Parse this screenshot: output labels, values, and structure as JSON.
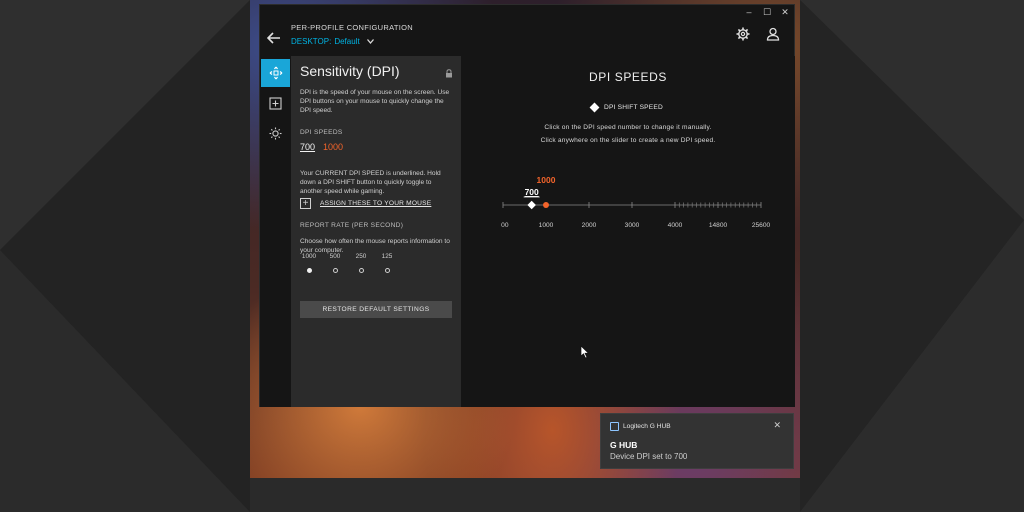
{
  "header": {
    "kicker": "PER-PROFILE CONFIGURATION",
    "profile_prefix": "DESKTOP:",
    "profile_name": "Default",
    "icons": [
      "back-arrow-icon",
      "gear-icon",
      "user-icon"
    ]
  },
  "window_controls": [
    "–",
    "☐",
    "✕"
  ],
  "rail": {
    "items": [
      {
        "name": "sensitivity",
        "icon": "move-arrows-icon",
        "active": true
      },
      {
        "name": "assignments",
        "icon": "plus-box-icon",
        "active": false
      },
      {
        "name": "lighting",
        "icon": "sun-icon",
        "active": false
      }
    ]
  },
  "panel": {
    "title": "Sensitivity (DPI)",
    "description": "DPI is the speed of your mouse on the screen. Use DPI buttons on your mouse to quickly change the DPI speed.",
    "dpi_speeds_label": "DPI SPEEDS",
    "dpi_speeds": {
      "current": "700",
      "shift": "1000"
    },
    "current_note": "Your CURRENT DPI SPEED is underlined. Hold down a DPI SHIFT button to quickly toggle to another speed while gaming.",
    "assign_label": "ASSIGN THESE TO YOUR MOUSE",
    "report_rate_label": "REPORT RATE (PER SECOND)",
    "report_rate_desc": "Choose how often the mouse reports information to your computer.",
    "report_rates": [
      {
        "value": "1000",
        "selected": true
      },
      {
        "value": "500",
        "selected": false
      },
      {
        "value": "250",
        "selected": false
      },
      {
        "value": "125",
        "selected": false
      }
    ],
    "restore_label": "RESTORE DEFAULT SETTINGS"
  },
  "main": {
    "title": "DPI SPEEDS",
    "shift_legend": "DPI SHIFT SPEED",
    "hint_1": "Click on the DPI speed number to change it manually.",
    "hint_2": "Click anywhere on the slider to create a new DPI speed."
  },
  "slider": {
    "scale_labels": [
      "100",
      "1000",
      "2000",
      "3000",
      "4000",
      "14800",
      "25600"
    ],
    "current_value": "700",
    "current_numeric": 700,
    "shift_value": "1000",
    "shift_numeric": 1000,
    "colors": {
      "current": "#ffffff",
      "shift": "#f2642b",
      "track": "#6a6a6a"
    }
  },
  "notification": {
    "app": "Logitech G HUB",
    "title": "G HUB",
    "message": "Device DPI set to 700"
  },
  "colors": {
    "accent": "#1aa6d8",
    "shift": "#f2642b"
  }
}
